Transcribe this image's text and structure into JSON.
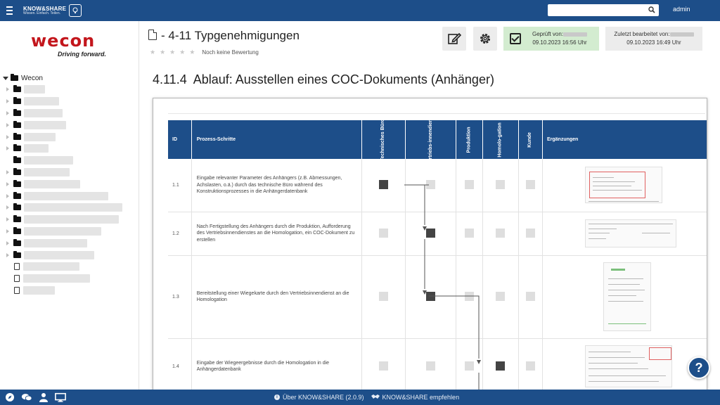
{
  "topbar": {
    "brand_line1": "KNOW&SHARE",
    "brand_line2": "Wissen. Einfach. Teilen.",
    "search_value": "",
    "user": "admin"
  },
  "sidebar": {
    "logo_word": "wecon",
    "logo_tagline": "Driving forward.",
    "tree_root": "Wecon"
  },
  "page": {
    "title": "- 4-11 Typgenehmigungen",
    "rating_text": "Noch keine Bewertung",
    "checked_label": "Geprüft von:",
    "checked_date": "09.10.2023 16:56 Uhr",
    "edited_label": "Zuletzt bearbeitet von:",
    "edited_date": "09.10.2023 16:49 Uhr",
    "section_number": "4.11.4",
    "section_title": "Ablauf: Ausstellen eines COC-Dokuments (Anhänger)"
  },
  "process_table": {
    "headers": {
      "id": "ID",
      "step": "Prozess-Schritte",
      "col1": "Technisches Büro",
      "col2": "Vertriebs-innendienst",
      "col3": "Produktion",
      "col4": "Homolo-gation",
      "col5": "Kunde",
      "extras": "Ergänzungen"
    },
    "rows": [
      {
        "id": "1.1",
        "text": "Eingabe relevanter Parameter des Anhängers (z.B. Abmessungen, Achslasten, o.ä.) durch das technische Büro während des Konstruktionsprozesses in die Anhängerdatenbank",
        "active": 1
      },
      {
        "id": "1.2",
        "text": "Nach Fertigstellung des Anhängers durch die Produktion, Aufforderung des Vertriebsinnendienstes an die Homologation, ein COC-Dokument zu erstellen",
        "active": 2
      },
      {
        "id": "1.3",
        "text": "Bereitstellung einer Wiegekarte durch den Vertriebsinnendienst an die Homologation",
        "active": 2
      },
      {
        "id": "1.4",
        "text": "Eingabe der Wiegeergebnisse durch die Homologation in die Anhängerdatenbank",
        "active": 4
      }
    ]
  },
  "footer": {
    "about": "Über KNOW&SHARE (2.0.9)",
    "recommend": "KNOW&SHARE empfehlen"
  },
  "help_label": "?",
  "colors": {
    "primary": "#1d4e89",
    "brand_red": "#c3161c",
    "checked_bg": "#d3ecd0"
  }
}
